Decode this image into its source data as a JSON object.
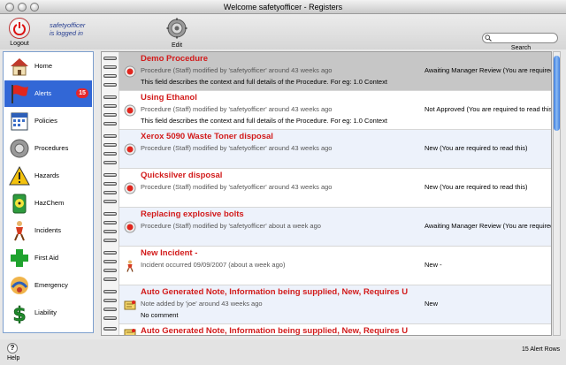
{
  "window": {
    "title": "Welcome safetyofficer - Registers"
  },
  "toolbar": {
    "logout_label": "Logout",
    "logged_in_user": "safetyofficer",
    "logged_in_text": "is logged in",
    "edit_label": "Edit",
    "search_label": "Search",
    "search_value": ""
  },
  "sidebar": {
    "items": [
      {
        "label": "Home",
        "icon": "home-icon"
      },
      {
        "label": "Alerts",
        "icon": "flag-icon",
        "badge": "15",
        "active": true
      },
      {
        "label": "Policies",
        "icon": "calendar-icon"
      },
      {
        "label": "Procedures",
        "icon": "gear-icon"
      },
      {
        "label": "Hazards",
        "icon": "warning-icon"
      },
      {
        "label": "HazChem",
        "icon": "radiation-icon"
      },
      {
        "label": "Incidents",
        "icon": "person-icon"
      },
      {
        "label": "First Aid",
        "icon": "first-aid-cross-icon"
      },
      {
        "label": "Emergency",
        "icon": "emergency-icon"
      },
      {
        "label": "Liability",
        "icon": "dollar-icon"
      }
    ]
  },
  "alerts": [
    {
      "title": "Demo Procedure",
      "meta": "Procedure (Staff) modified by 'safetyofficer' around 43 weeks ago",
      "desc": "This field describes the context and full details of the Procedure.  For eg:  1.0 Context",
      "status": "Awaiting Manager Review (You are required to re",
      "icon": "red-dot-icon"
    },
    {
      "title": "Using Ethanol",
      "meta": "Procedure (Staff) modified by 'safetyofficer' around 43 weeks ago",
      "desc": "This field describes the context and full details of the Procedure.  For eg:  1.0 Context",
      "status": "Not Approved (You are required to read this)",
      "icon": "red-dot-icon"
    },
    {
      "title": "Xerox 5090 Waste Toner disposal",
      "meta": "Procedure (Staff) modified by 'safetyofficer' around 43 weeks ago",
      "desc": "",
      "status": "New (You are required to read this)",
      "icon": "red-dot-icon"
    },
    {
      "title": "Quicksilver disposal",
      "meta": "Procedure (Staff) modified by 'safetyofficer' around 43 weeks ago",
      "desc": "",
      "status": "New (You are required to read this)",
      "icon": "red-dot-icon"
    },
    {
      "title": "Replacing explosive bolts",
      "meta": "Procedure (Staff) modified by 'safetyofficer' about a week ago",
      "desc": "",
      "status": "Awaiting Manager Review (You are required to re",
      "icon": "red-dot-icon"
    },
    {
      "title": "New Incident -",
      "meta": "Incident occurred 09/09/2007 (about a week ago)",
      "desc": "",
      "status": "New -",
      "icon": "incident-person-icon"
    },
    {
      "title": "Auto Generated Note, Information being supplied, New, Requires U",
      "meta": "Note added by 'joe' around 43 weeks ago",
      "desc": "No comment",
      "status": "New",
      "icon": "note-icon"
    },
    {
      "title": "Auto Generated Note, Information being supplied, New, Requires U",
      "meta": "",
      "desc": "",
      "status": "",
      "icon": "note-icon"
    }
  ],
  "footer": {
    "help_label": "Help",
    "row_count": "15 Alert Rows"
  }
}
